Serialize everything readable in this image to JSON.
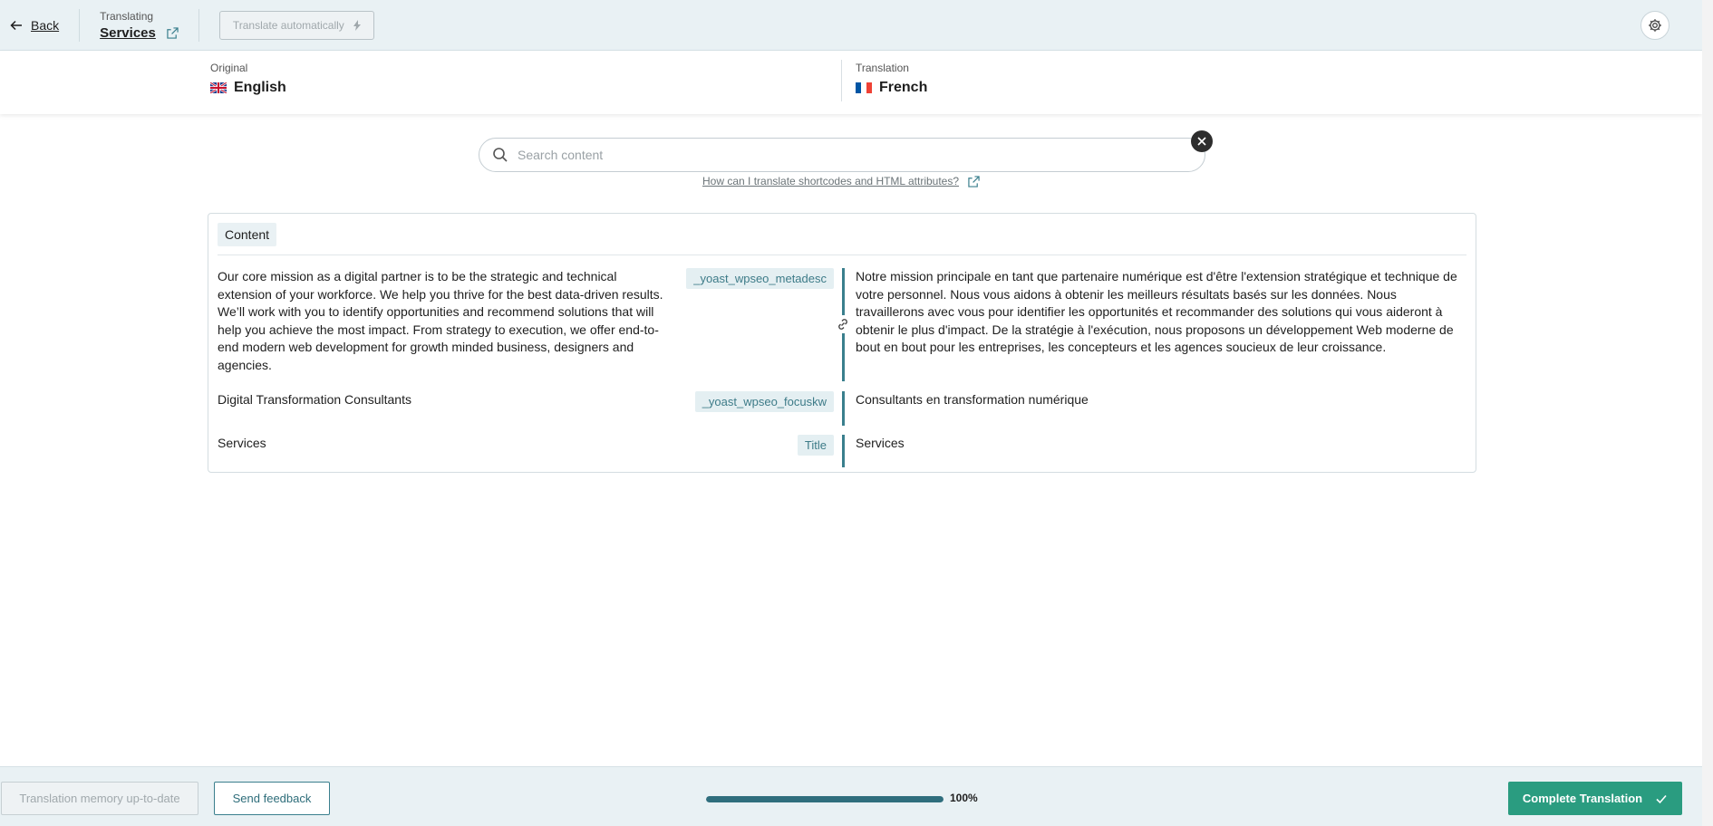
{
  "topbar": {
    "back_label": "Back",
    "translating_label": "Translating",
    "page_name": "Services",
    "translate_auto_label": "Translate automatically"
  },
  "languages": {
    "original_label": "Original",
    "original_name": "English",
    "translation_label": "Translation",
    "translation_name": "French"
  },
  "search": {
    "placeholder": "Search content",
    "help_link": "How can I translate shortcodes and HTML attributes?"
  },
  "section": {
    "title": "Content",
    "rows": [
      {
        "source": "Our core mission as a digital partner is to be the strategic and technical extension of your workforce. We help you thrive for the best data-driven results. We’ll work with you to identify opportunities and recommend solutions that will help you achieve the most impact. From strategy to execution, we offer end-to-end modern web development for growth minded business, designers and agencies.",
        "key": "_yoast_wpseo_metadesc",
        "target": "Notre mission principale en tant que partenaire numérique est d'être l'extension stratégique et technique de votre personnel. Nous vous aidons à obtenir les meilleurs résultats basés sur les données. Nous travaillerons avec vous pour identifier les opportunités et recommander des solutions qui vous aideront à obtenir le plus d'impact. De la stratégie à l'exécution, nous proposons un développement Web moderne de bout en bout pour les entreprises, les concepteurs et les agences soucieux de leur croissance."
      },
      {
        "source": "Digital Transformation Consultants",
        "key": "_yoast_wpseo_focuskw",
        "target": "Consultants en transformation numérique"
      },
      {
        "source": "Services",
        "key": "Title",
        "target": "Services"
      }
    ]
  },
  "footer": {
    "memory_label": "Translation memory up-to-date",
    "feedback_label": "Send feedback",
    "progress_value": 100,
    "progress_text": "100%",
    "complete_label": "Complete Translation"
  },
  "colors": {
    "accent": "#3a7f8d",
    "complete": "#2a9c80",
    "topbar_bg": "#e9f1f4"
  }
}
